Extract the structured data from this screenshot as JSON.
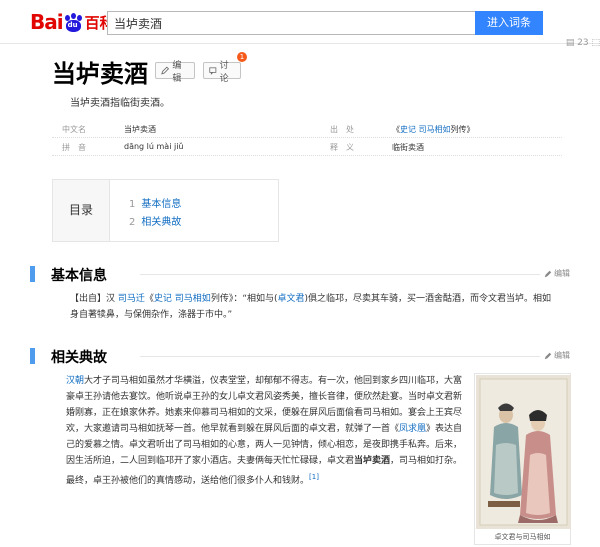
{
  "header": {
    "logo_bai": "Bai",
    "logo_du": "du",
    "logo_baike": "百科",
    "search_value": "当垆卖酒",
    "search_button": "进入词条",
    "right_text": "▤ 23 ⬚"
  },
  "title": {
    "text": "当垆卖酒",
    "edit_label": "编辑",
    "discuss_label": "讨论",
    "badge_count": "1"
  },
  "summary": "当垆卖酒指临街卖酒。",
  "info": {
    "rows": [
      {
        "l1": "中文名",
        "v1": "当垆卖酒",
        "l2": "出　处",
        "v2_pre": "《",
        "v2_link1": "史记",
        "v2_space": " ",
        "v2_link2": "司马相如",
        "v2_post": "列传》"
      },
      {
        "l1": "拼　音",
        "v1": "dāng lú mài jiǔ",
        "l2": "释　义",
        "v2": "临街卖酒"
      }
    ]
  },
  "catalog": {
    "head": "目录",
    "items": [
      {
        "num": "1",
        "text": "基本信息"
      },
      {
        "num": "2",
        "text": "相关典故"
      }
    ]
  },
  "sections": [
    {
      "title": "基本信息",
      "edit": "编辑"
    },
    {
      "title": "相关典故",
      "edit": "编辑"
    }
  ],
  "para1": {
    "t1": "【出自】汉 ",
    "l1": "司马迁",
    "t2": "《",
    "l2": "史记",
    "t3": " ",
    "l3": "司马相如",
    "t4": "列传》：“相如与(",
    "l4": "卓文君",
    "t5": ")俱之临邛，尽卖其车骑，买一酒舍酤酒，而令文君当垆。相如身自著犊鼻，与保佣杂作，涤器于市中。”"
  },
  "para2": {
    "l1": "汉朝",
    "t1": "大才子司马相如虽然才华横溢，仪表堂堂，却郁郁不得志。有一次，他回到家乡四川临邛，大富豪卓王孙请他去宴饮。他听说卓王孙的女儿卓文君风姿秀美，擅长音律，便欣然赴宴。当时卓文君新婚刚寡，正在娘家休养。她素来仰慕司马相如的文采，便躲在屏风后面偷看司马相如。宴会上王宾尽欢，大家邀请司马相如抚琴一首。他早就看到躲在屏风后面的卓文君，就弹了一首《",
    "l2": "凤求凰",
    "t2": "》表达自己的爱慕之情。卓文君听出了司马相如的心意，两人一见钟情，倾心相恋，是夜即携手私奔。后来，因生活所迫，二人回到临邛开了家小酒店。夫妻俩每天忙忙碌碌，卓文君",
    "b1": "当垆卖酒",
    "t3": "，司马相如打杂。最终，卓王孙被他们的真情感动，送给他们很多仆人和钱财。",
    "sup": "[1]"
  },
  "figure": {
    "caption": "卓文君与司马相如"
  },
  "colors": {
    "brand_red": "#e10602",
    "brand_blue": "#2319dc",
    "search_button": "#3385ff",
    "link": "#136ec2",
    "section_bar": "#4f9cee"
  }
}
